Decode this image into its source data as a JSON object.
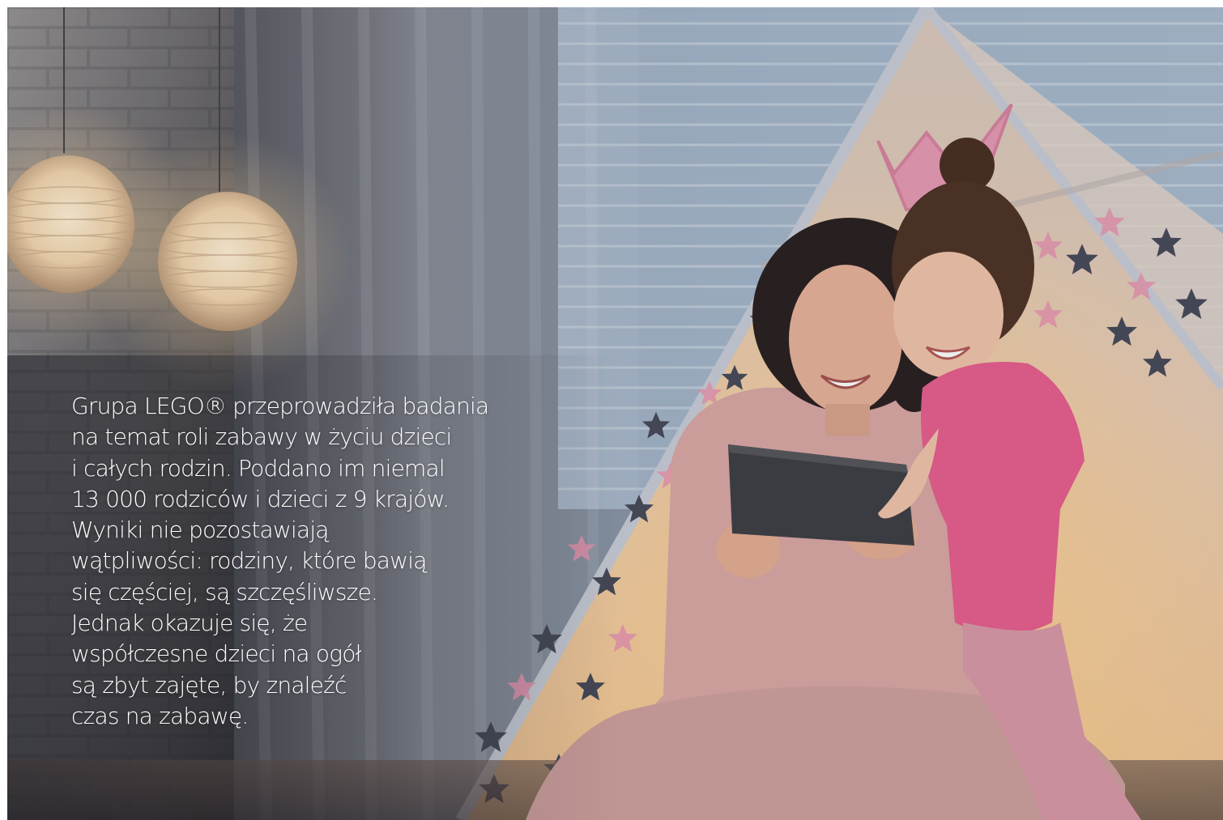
{
  "banner": {
    "image": "mother and daughter laughing at a tablet inside a star-patterned play tent, paper lanterns on brick wall",
    "colors": {
      "tent_canvas": "#e2cbb7",
      "tent_trim": "#cfd4dc",
      "star_dark": "#474a58",
      "star_pink": "#e996b0",
      "shirt_pink": "#e85f8e",
      "lantern_glow": "#ffe0b0",
      "text": "#ffffff"
    },
    "text_lines": [
      "Grupa LEGO® przeprowadziła badania",
      "na temat roli zabawy w życiu dzieci",
      "i całych rodzin. Poddano im niemal",
      "13 000 rodziców i dzieci z 9 krajów.",
      "Wyniki nie pozostawiają",
      "wątpliwości: rodziny, które bawią",
      "się częściej, są szczęśliwsze.",
      "Jednak okazuje się, że",
      "współczesne dzieci na ogół",
      "są zbyt zajęte, by znaleźć",
      "czas na zabawę."
    ]
  }
}
